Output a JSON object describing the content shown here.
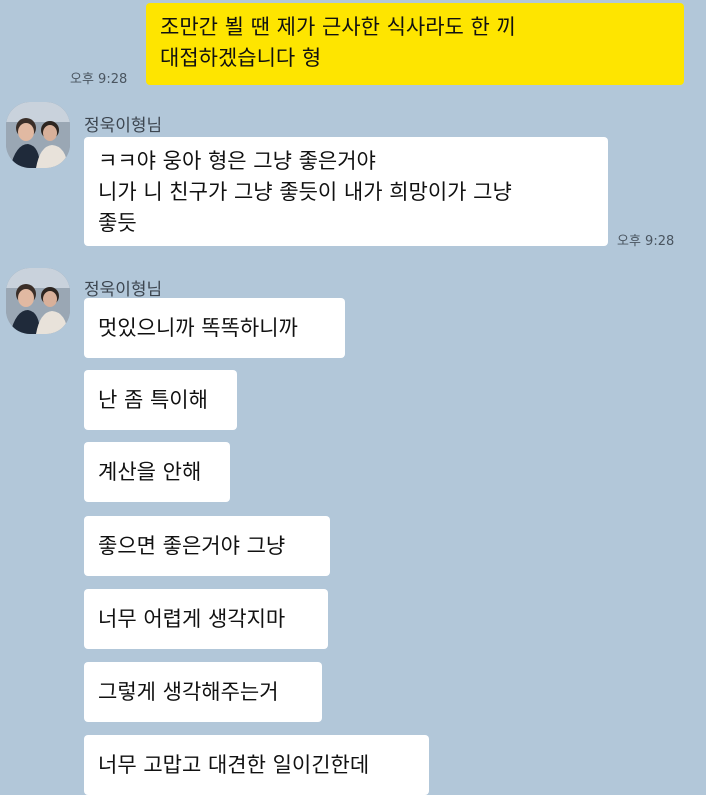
{
  "colors": {
    "background": "#b2c7d9",
    "my_bubble": "#fee500",
    "other_bubble": "#ffffff"
  },
  "messages": {
    "mine_1": {
      "text": "조만간 뵐 땐 제가 근사한 식사라도 한 끼\n대접하겠습니다 형",
      "time": "오후 9:28"
    },
    "group_1": {
      "sender": "정욱이형님",
      "text": "ㅋㅋ야 웅아 형은 그냥 좋은거야\n니가 니 친구가 그냥 좋듯이 내가 희망이가 그냥\n좋듯",
      "time": "오후 9:28"
    },
    "group_2": {
      "sender": "정욱이형님",
      "lines": [
        "멋있으니까 똑똑하니까",
        "난 좀 특이해",
        "계산을 안해",
        "좋으면 좋은거야 그냥",
        "너무 어렵게 생각지마",
        "그렇게 생각해주는거",
        "너무 고맙고 대견한 일이긴한데"
      ]
    }
  },
  "icons": {
    "avatar": "profile-photo-icon"
  }
}
